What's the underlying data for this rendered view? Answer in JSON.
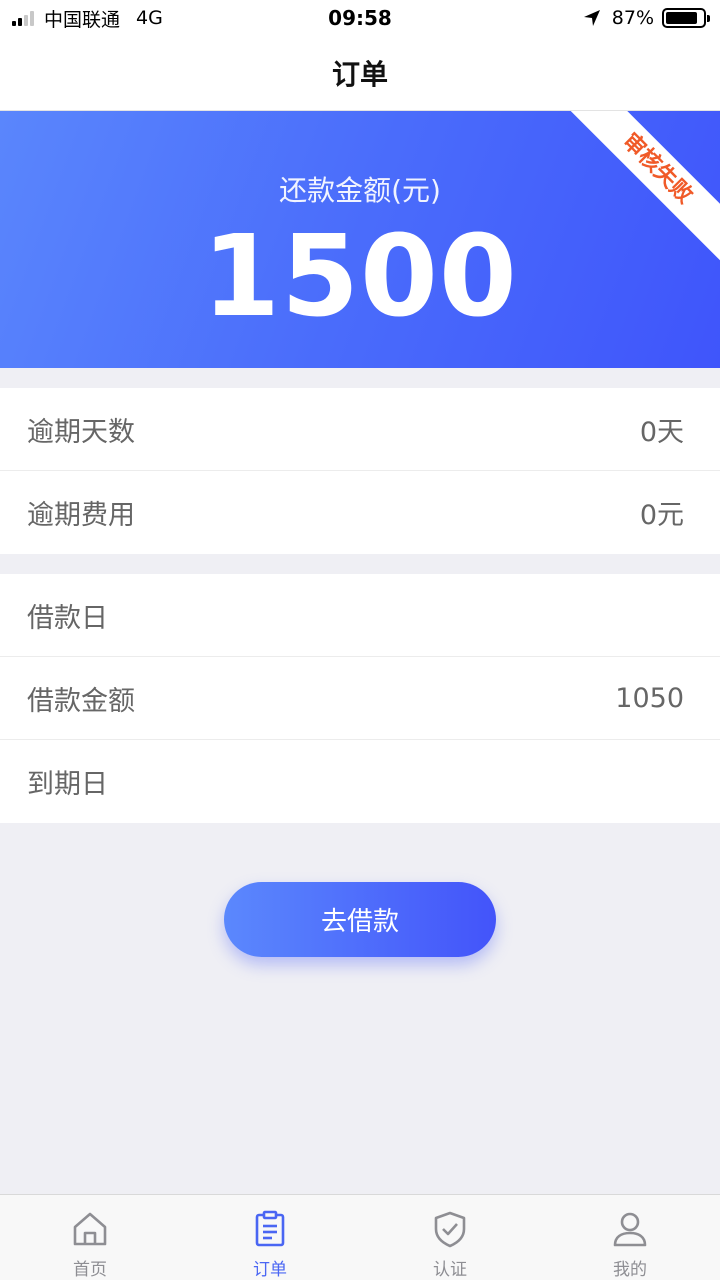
{
  "status_bar": {
    "carrier": "中国联通",
    "network": "4G",
    "time": "09:58",
    "battery": "87%",
    "battery_level": 0.87
  },
  "nav": {
    "title": "订单"
  },
  "banner": {
    "label": "还款金额(元)",
    "amount": "1500",
    "ribbon": "审核失败",
    "ribbon_color": "#f05a28"
  },
  "overdue": {
    "rows": [
      {
        "label": "逾期天数",
        "value": "0天"
      },
      {
        "label": "逾期费用",
        "value": "0元"
      }
    ]
  },
  "loan": {
    "rows": [
      {
        "label": "借款日",
        "value": ""
      },
      {
        "label": "借款金额",
        "value": "1050"
      },
      {
        "label": "到期日",
        "value": ""
      }
    ]
  },
  "cta": {
    "label": "去借款"
  },
  "tabs": [
    {
      "label": "首页",
      "icon": "home-icon",
      "active": false
    },
    {
      "label": "订单",
      "icon": "order-icon",
      "active": true
    },
    {
      "label": "认证",
      "icon": "shield-check-icon",
      "active": false
    },
    {
      "label": "我的",
      "icon": "user-icon",
      "active": false
    }
  ],
  "colors": {
    "accent": "#4a66f3",
    "banner_start": "#5a86fc",
    "banner_end": "#3f55fb",
    "inactive_tab": "#8e8e93"
  }
}
